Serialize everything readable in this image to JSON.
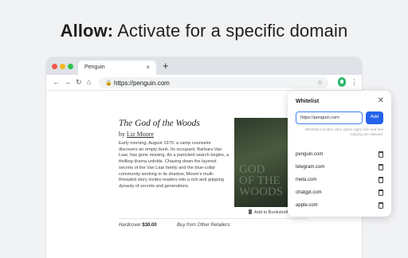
{
  "headline": {
    "bold": "Allow:",
    "rest": " Activate for a specific domain"
  },
  "browser": {
    "tab_title": "Penguin",
    "tab_close": "×",
    "new_tab": "+",
    "url": "https://penguin.com",
    "nav": {
      "back": "←",
      "forward": "→",
      "reload": "↻",
      "home": "⌂",
      "lock": "🔒",
      "star": "☆",
      "menu": "⋮"
    }
  },
  "page": {
    "title": "The God of the Woods",
    "by": "by ",
    "author": "Liz Moore",
    "description": "Early morning, August 1975: a camp counselor discovers an empty bunk. Its occupant, Barbara Van Laar, has gone missing. As a panicked search begins, a thrilling drama unfolds. Chasing down the layered secrets of the Van Laar family and the blue-collar community working in its shadow, Moore's multi-threaded story invites readers into a rich and gripping dynasty of secrets and generations.",
    "add_to_bookshelf": "Add to Bookshelf",
    "hardcover_label": "Hardcover",
    "hardcover_price": "$30.00",
    "buy_from": "Buy from Other Retailers:"
  },
  "popup": {
    "title": "Whitelist",
    "close": "✕",
    "input_value": "https://penguin.com",
    "add_label": "Add",
    "hint": "Whitelist includes sites where right-click and text copying are allowed.",
    "domains": [
      "penguin.com",
      "telegram.com",
      "meta.com",
      "chatgpt.com",
      "apple.com"
    ]
  },
  "colors": {
    "accent": "#2563eb",
    "extension": "#2db86a"
  }
}
